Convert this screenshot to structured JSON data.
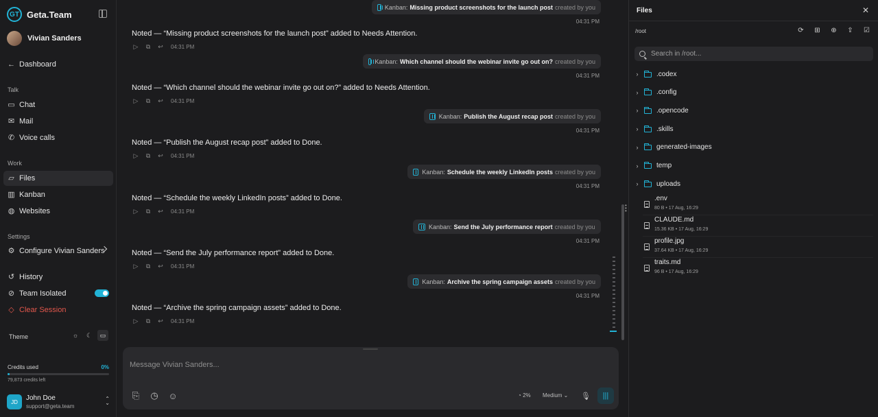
{
  "sidebar": {
    "brand": "Geta.Team",
    "brand_logo_text": "GT",
    "agent_name": "Vivian Sanders",
    "dashboard": "Dashboard",
    "sections": {
      "talk": "Talk",
      "work": "Work",
      "settings": "Settings"
    },
    "talk_items": [
      {
        "label": "Chat",
        "icon": "chat-icon"
      },
      {
        "label": "Mail",
        "icon": "mail-icon"
      },
      {
        "label": "Voice calls",
        "icon": "phone-icon"
      }
    ],
    "work_items": [
      {
        "label": "Files",
        "icon": "folder-icon",
        "active": true
      },
      {
        "label": "Kanban",
        "icon": "kanban-icon"
      },
      {
        "label": "Websites",
        "icon": "globe-icon"
      }
    ],
    "configure": "Configure Vivian Sanders",
    "history": "History",
    "team_isolated": "Team Isolated",
    "team_isolated_on": true,
    "clear_session": "Clear Session",
    "theme_label": "Theme",
    "theme_selected": "system",
    "credits_label": "Credits used",
    "credits_pct": "0%",
    "credits_fill": 0.02,
    "credits_left": "79,873 credits left",
    "account": {
      "initials": "JD",
      "name": "John Doe",
      "email": "support@geta.team"
    }
  },
  "chat": {
    "kanban_label": "Kanban:",
    "created_by": "created by you",
    "messages": [
      {
        "card": "Missing product screenshots for the launch post",
        "time": "04:31 PM",
        "reply": "Noted — “Missing product screenshots for the launch post” added to Needs Attention.",
        "reply_time": "04:31 PM"
      },
      {
        "card": "Which channel should the webinar invite go out on?",
        "time": "04:31 PM",
        "reply": "Noted — “Which channel should the webinar invite go out on?” added to Needs Attention.",
        "reply_time": "04:31 PM"
      },
      {
        "card": "Publish the August recap post",
        "time": "04:31 PM",
        "reply": "Noted — “Publish the August recap post” added to Done.",
        "reply_time": "04:31 PM"
      },
      {
        "card": "Schedule the weekly LinkedIn posts",
        "time": "04:31 PM",
        "reply": "Noted — “Schedule the weekly LinkedIn posts” added to Done.",
        "reply_time": "04:31 PM"
      },
      {
        "card": "Send the July performance report",
        "time": "04:31 PM",
        "reply": "Noted — “Send the July performance report” added to Done.",
        "reply_time": "04:31 PM"
      },
      {
        "card": "Archive the spring campaign assets",
        "time": "04:31 PM",
        "reply": "Noted — “Archive the spring campaign assets” added to Done.",
        "reply_time": "04:31 PM"
      }
    ],
    "composer": {
      "placeholder": "Message Vivian Sanders...",
      "context_pct": "2%",
      "effort": "Medium"
    }
  },
  "files": {
    "title": "Files",
    "path": "/root",
    "search_placeholder": "Search in /root...",
    "folders": [
      ".codex",
      ".config",
      ".opencode",
      ".skills",
      "generated-images",
      "temp",
      "uploads"
    ],
    "items": [
      {
        "name": ".env",
        "meta": "80 B • 17 Aug, 16:29"
      },
      {
        "name": "CLAUDE.md",
        "meta": "15.36 KB • 17 Aug, 16:29"
      },
      {
        "name": "profile.jpg",
        "meta": "37.64 KB • 17 Aug, 16:29"
      },
      {
        "name": "traits.md",
        "meta": "96 B • 17 Aug, 16:29"
      }
    ]
  },
  "colors": {
    "accent": "#22b3d6",
    "danger": "#e2574c",
    "background": "#1c1c1e"
  }
}
